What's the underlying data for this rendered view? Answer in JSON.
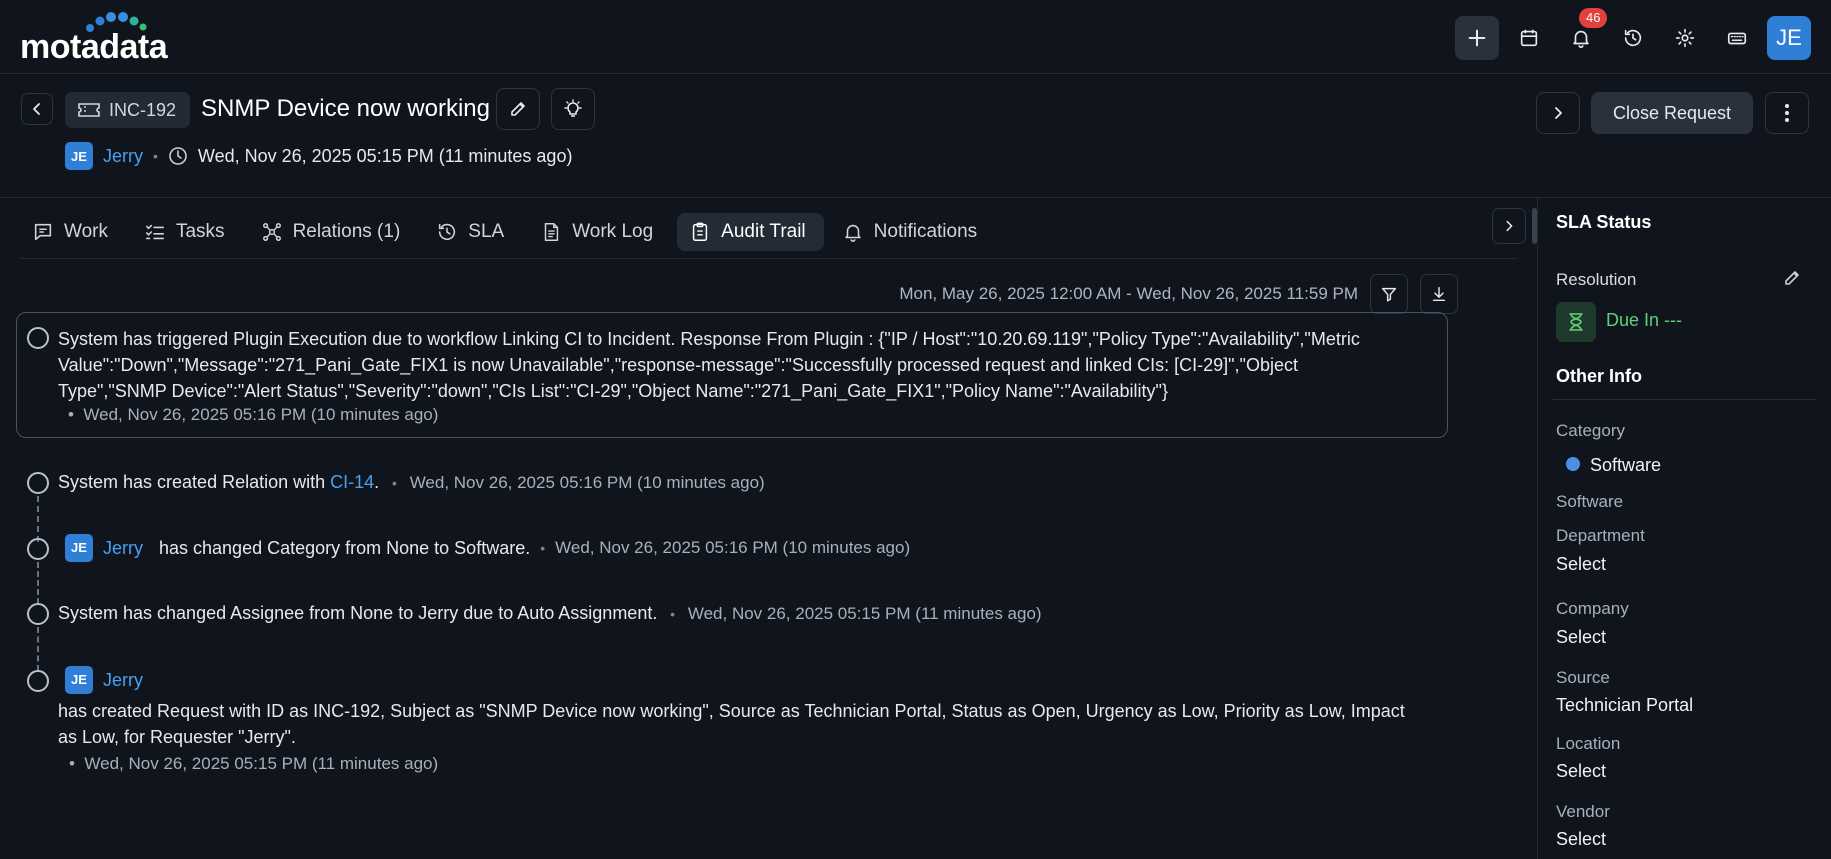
{
  "app": {
    "logo_text": "motadata",
    "notification_count": "46",
    "user_initials": "JE"
  },
  "request": {
    "id": "INC-192",
    "title": "SNMP Device now working",
    "requester": "Jerry",
    "requester_initials": "JE",
    "created": "Wed, Nov 26, 2025 05:15 PM (11 minutes ago)",
    "close_label": "Close Request"
  },
  "tabs": [
    {
      "label": "Work",
      "icon": "chat-icon"
    },
    {
      "label": "Tasks",
      "icon": "checklist-icon"
    },
    {
      "label": "Relations (1)",
      "icon": "relations-icon"
    },
    {
      "label": "SLA",
      "icon": "history-icon"
    },
    {
      "label": "Work Log",
      "icon": "document-icon"
    },
    {
      "label": "Audit Trail",
      "icon": "clipboard-icon",
      "active": true
    },
    {
      "label": "Notifications",
      "icon": "bell-icon"
    }
  ],
  "audit": {
    "date_range": "Mon, May 26, 2025 12:00 AM - Wed, Nov 26, 2025 11:59 PM",
    "entries": [
      {
        "line1": "System has triggered Plugin Execution due to workflow Linking CI to Incident. Response From Plugin : {\"IP / Host\":\"10.20.69.119\",\"Policy Type\":\"Availability\",\"Metric",
        "line2": "Value\":\"Down\",\"Message\":\"271_Pani_Gate_FIX1 is now Unavailable\",\"response-message\":\"Successfully processed request and linked CIs: [CI-29]\",\"Object",
        "line3": "Type\",\"SNMP Device\":\"Alert Status\",\"Severity\":\"down\",\"CIs List\":\"CI-29\",\"Object Name\":\"271_Pani_Gate_FIX1\",\"Policy Name\":\"Availability\"}",
        "time": "Wed, Nov 26, 2025 05:16 PM (10 minutes ago)"
      },
      {
        "text": "System has created Relation with",
        "link": "CI-14",
        "suffix": ".",
        "time": "Wed, Nov 26, 2025 05:16 PM (10 minutes ago)"
      },
      {
        "actor": "Jerry",
        "actor_initials": "JE",
        "text": "has changed Category from None to Software.",
        "time": "Wed, Nov 26, 2025 05:16 PM (10 minutes ago)"
      },
      {
        "text": "System has changed Assignee from None to Jerry due to Auto Assignment.",
        "time": "Wed, Nov 26, 2025 05:15 PM (11 minutes ago)"
      },
      {
        "actor": "Jerry",
        "actor_initials": "JE",
        "line1": "has created Request with ID as INC-192, Subject as \"SNMP Device now working\", Source as Technician Portal, Status as Open, Urgency as Low, Priority as Low, Impact",
        "line2": "as Low, for Requester \"Jerry\".",
        "time": "Wed, Nov 26, 2025 05:15 PM (11 minutes ago)"
      }
    ]
  },
  "sidebar": {
    "sla_title": "SLA Status",
    "resolution_label": "Resolution",
    "due_in": "Due In ---",
    "other_info_title": "Other Info",
    "category_label": "Category",
    "category_value": "Software",
    "subcategory_value": "Software",
    "department_label": "Department",
    "department_value": "Select",
    "company_label": "Company",
    "company_value": "Select",
    "source_label": "Source",
    "source_value": "Technician Portal",
    "location_label": "Location",
    "location_value": "Select",
    "vendor_label": "Vendor",
    "vendor_value": "Select"
  },
  "colors": {
    "background": "#10151d",
    "accent": "#2f7fd6",
    "link": "#4aa0f0",
    "due": "#5fd07a",
    "badge": "#e2403a"
  }
}
